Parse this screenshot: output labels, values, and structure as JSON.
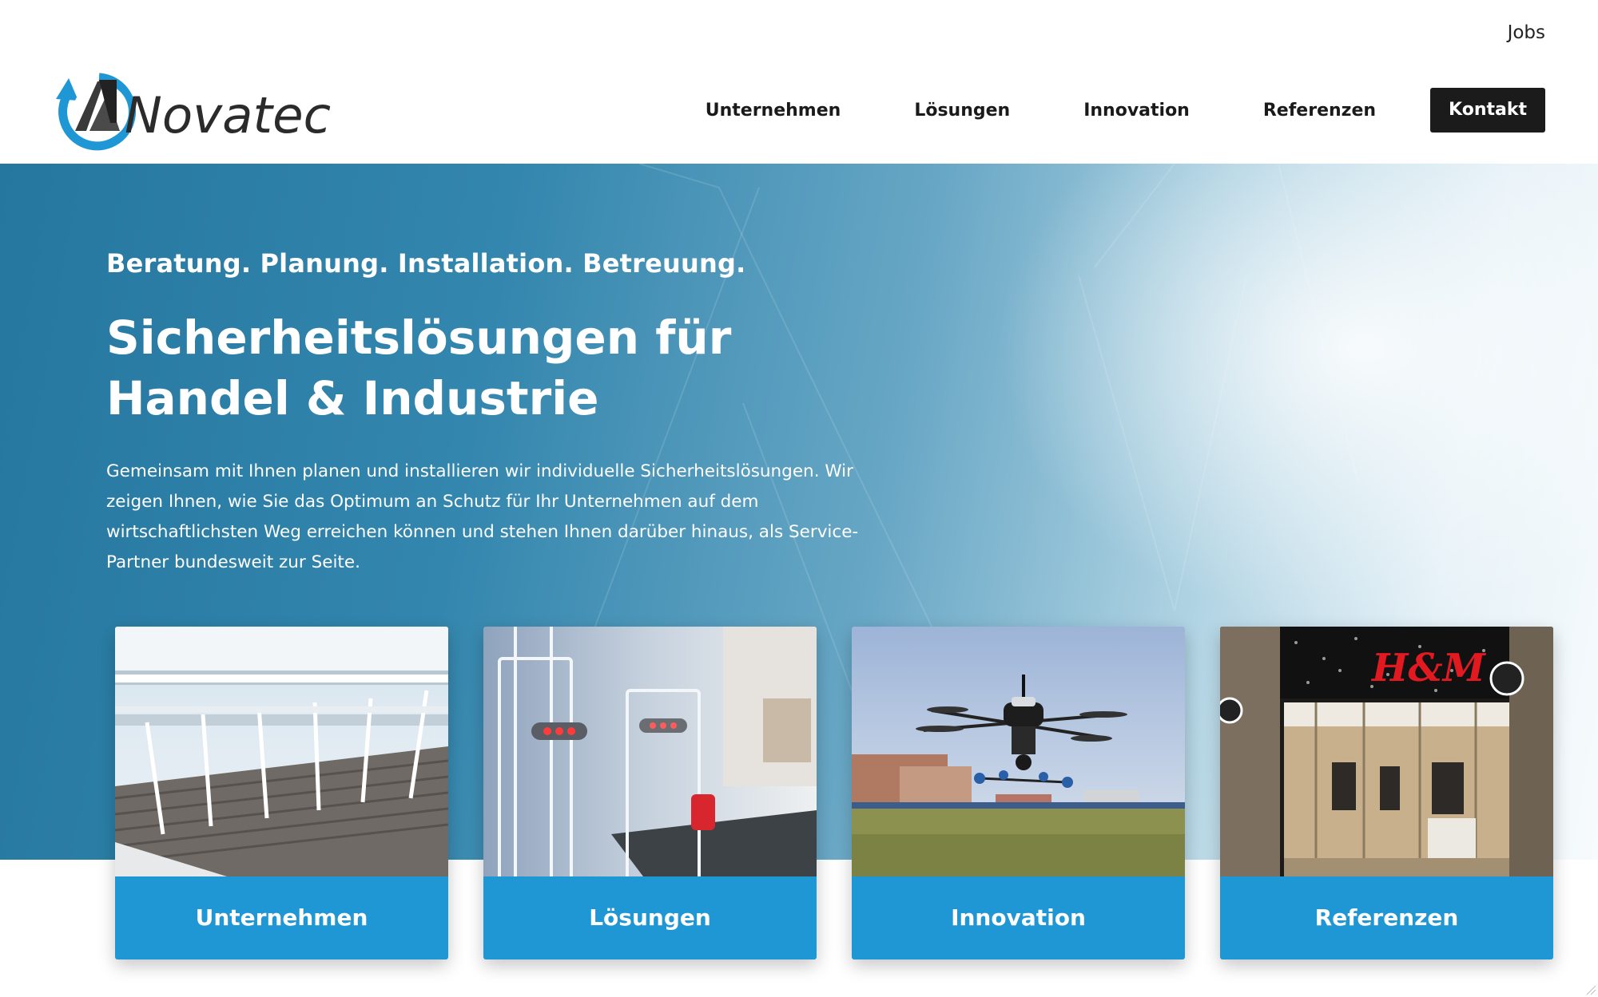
{
  "header": {
    "utility_link": "Jobs",
    "logo_text": "Novatec",
    "nav_items": [
      "Unternehmen",
      "Lösungen",
      "Innovation",
      "Referenzen"
    ],
    "cta_label": "Kontakt"
  },
  "hero": {
    "tagline": "Beratung. Planung. Installation. Betreuung.",
    "title_line1": "Sicherheitslösungen für",
    "title_line2": "Handel & Industrie",
    "text": "Gemeinsam mit Ihnen planen und installieren wir individuelle Sicherheitslösungen. Wir zeigen Ihnen, wie Sie das Optimum an Schutz für Ihr Unternehmen auf dem wirtschaftlichsten Weg erreichen können und stehen Ihnen darüber hinaus, als Service-Partner bundesweit zur Seite."
  },
  "cards": [
    {
      "label": "Unternehmen"
    },
    {
      "label": "Lösungen"
    },
    {
      "label": "Innovation"
    },
    {
      "label": "Referenzen"
    }
  ],
  "colors": {
    "accent_blue": "#1f97d4",
    "hero_blue": "#25779f",
    "cta_dark": "#1b1b1b"
  }
}
